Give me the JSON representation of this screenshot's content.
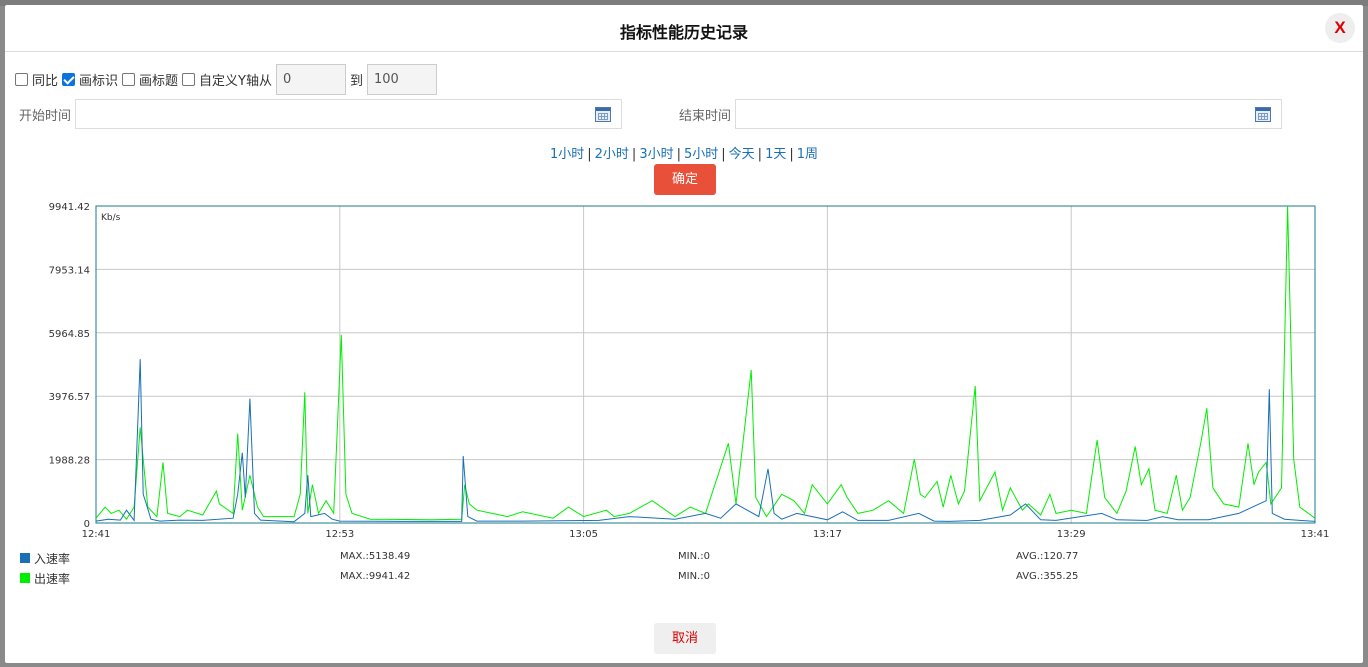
{
  "dialog": {
    "title": "指标性能历史记录",
    "close_label": "X"
  },
  "options": {
    "yoy_label": "同比",
    "yoy_checked": false,
    "draw_marks_label": "画标识",
    "draw_marks_checked": true,
    "draw_title_label": "画标题",
    "draw_title_checked": false,
    "custom_y_label": "自定义Y轴从",
    "custom_y_checked": false,
    "y_from": "0",
    "to_label": "到",
    "y_to": "100"
  },
  "time": {
    "start_label": "开始时间",
    "start_value": "",
    "end_label": "结束时间",
    "end_value": ""
  },
  "ranges": [
    "1小时",
    "2小时",
    "3小时",
    "5小时",
    "今天",
    "1天",
    "1周"
  ],
  "range_separator": "|",
  "confirm_label": "确定",
  "cancel_label": "取消",
  "colors": {
    "in_rate": "#1a6fb5",
    "out_rate": "#00ee00",
    "confirm": "#e8503a"
  },
  "chart_data": {
    "type": "line",
    "unit": "Kb/s",
    "ylim": [
      0,
      9941.42
    ],
    "yticks": [
      "0",
      "1988.28",
      "3976.57",
      "5964.85",
      "7953.14",
      "9941.42"
    ],
    "xticks": [
      "12:41",
      "12:53",
      "13:05",
      "13:17",
      "13:29",
      "13:41"
    ],
    "x_start": "12:41",
    "x_end": "13:41",
    "grid": true,
    "series": [
      {
        "name": "入速率",
        "max": "MAX.:5138.49",
        "min": "MIN.:0",
        "avg": "AVG.:120.77",
        "points": [
          [
            0,
            60
          ],
          [
            0.8,
            120
          ],
          [
            1.6,
            90
          ],
          [
            2,
            400
          ],
          [
            2.5,
            80
          ],
          [
            2.9,
            5138
          ],
          [
            3.1,
            900
          ],
          [
            3.3,
            600
          ],
          [
            3.6,
            120
          ],
          [
            4.2,
            60
          ],
          [
            5.5,
            90
          ],
          [
            7,
            80
          ],
          [
            9,
            150
          ],
          [
            9.3,
            900
          ],
          [
            9.6,
            2200
          ],
          [
            9.8,
            800
          ],
          [
            10.1,
            3900
          ],
          [
            10.4,
            300
          ],
          [
            10.8,
            90
          ],
          [
            13,
            40
          ],
          [
            13.7,
            300
          ],
          [
            13.9,
            1500
          ],
          [
            14.1,
            200
          ],
          [
            15,
            300
          ],
          [
            15.5,
            120
          ],
          [
            16,
            60
          ],
          [
            20,
            50
          ],
          [
            24,
            50
          ],
          [
            24.1,
            2100
          ],
          [
            24.4,
            200
          ],
          [
            25,
            60
          ],
          [
            28,
            60
          ],
          [
            33,
            80
          ],
          [
            35,
            200
          ],
          [
            38,
            120
          ],
          [
            40,
            300
          ],
          [
            41,
            150
          ],
          [
            42,
            600
          ],
          [
            43.5,
            200
          ],
          [
            44.1,
            1700
          ],
          [
            44.5,
            300
          ],
          [
            45,
            120
          ],
          [
            46,
            300
          ],
          [
            48,
            100
          ],
          [
            49,
            350
          ],
          [
            50,
            80
          ],
          [
            52,
            80
          ],
          [
            54,
            300
          ],
          [
            55,
            60
          ],
          [
            56,
            50
          ],
          [
            58,
            80
          ],
          [
            60,
            250
          ],
          [
            61,
            600
          ],
          [
            62,
            100
          ],
          [
            63,
            80
          ],
          [
            66,
            300
          ],
          [
            67,
            100
          ],
          [
            69,
            80
          ],
          [
            70,
            200
          ],
          [
            71,
            100
          ],
          [
            73,
            100
          ],
          [
            75,
            300
          ],
          [
            76.8,
            700
          ],
          [
            77,
            4200
          ],
          [
            77.2,
            300
          ],
          [
            78,
            120
          ],
          [
            79,
            80
          ],
          [
            80,
            50
          ]
        ]
      },
      {
        "name": "出速率",
        "max": "MAX.:9941.42",
        "min": "MIN.:0",
        "avg": "AVG.:355.25",
        "points": [
          [
            0,
            150
          ],
          [
            0.6,
            500
          ],
          [
            1,
            300
          ],
          [
            1.5,
            400
          ],
          [
            2,
            120
          ],
          [
            2.5,
            500
          ],
          [
            2.9,
            3000
          ],
          [
            3.1,
            2000
          ],
          [
            3.4,
            500
          ],
          [
            4,
            200
          ],
          [
            4.4,
            1900
          ],
          [
            4.7,
            300
          ],
          [
            5.5,
            200
          ],
          [
            6,
            400
          ],
          [
            7,
            250
          ],
          [
            7.9,
            1000
          ],
          [
            8.1,
            600
          ],
          [
            9,
            300
          ],
          [
            9.3,
            2800
          ],
          [
            9.6,
            400
          ],
          [
            10.1,
            1500
          ],
          [
            10.6,
            500
          ],
          [
            11,
            200
          ],
          [
            13,
            200
          ],
          [
            13.4,
            900
          ],
          [
            13.7,
            4100
          ],
          [
            13.9,
            300
          ],
          [
            14.2,
            1200
          ],
          [
            14.6,
            300
          ],
          [
            15.1,
            700
          ],
          [
            15.6,
            300
          ],
          [
            16.1,
            5900
          ],
          [
            16.4,
            900
          ],
          [
            16.8,
            300
          ],
          [
            18,
            120
          ],
          [
            22,
            100
          ],
          [
            24,
            120
          ],
          [
            24.2,
            1200
          ],
          [
            24.5,
            600
          ],
          [
            25,
            400
          ],
          [
            26,
            300
          ],
          [
            27,
            200
          ],
          [
            28,
            350
          ],
          [
            30,
            150
          ],
          [
            31,
            500
          ],
          [
            32,
            200
          ],
          [
            33.5,
            400
          ],
          [
            34,
            200
          ],
          [
            35,
            300
          ],
          [
            36.5,
            700
          ],
          [
            38,
            200
          ],
          [
            39,
            500
          ],
          [
            40,
            300
          ],
          [
            41.5,
            2500
          ],
          [
            42,
            600
          ],
          [
            43,
            4800
          ],
          [
            43.3,
            800
          ],
          [
            44,
            200
          ],
          [
            45,
            900
          ],
          [
            45.8,
            700
          ],
          [
            46.5,
            300
          ],
          [
            47,
            1200
          ],
          [
            48,
            600
          ],
          [
            48.9,
            1200
          ],
          [
            49.3,
            800
          ],
          [
            50,
            300
          ],
          [
            51,
            400
          ],
          [
            52,
            700
          ],
          [
            53,
            300
          ],
          [
            53.7,
            2000
          ],
          [
            54.1,
            900
          ],
          [
            54.4,
            800
          ],
          [
            55.2,
            1300
          ],
          [
            55.6,
            500
          ],
          [
            56.1,
            1500
          ],
          [
            56.6,
            600
          ],
          [
            57,
            1000
          ],
          [
            57.7,
            4300
          ],
          [
            58,
            700
          ],
          [
            59,
            1600
          ],
          [
            59.5,
            400
          ],
          [
            60,
            1100
          ],
          [
            60.8,
            400
          ],
          [
            61.2,
            600
          ],
          [
            62,
            250
          ],
          [
            62.6,
            900
          ],
          [
            63,
            300
          ],
          [
            64,
            400
          ],
          [
            65,
            300
          ],
          [
            65.7,
            2600
          ],
          [
            66.2,
            800
          ],
          [
            67,
            300
          ],
          [
            67.6,
            1000
          ],
          [
            68.2,
            2400
          ],
          [
            68.6,
            1200
          ],
          [
            69.1,
            1700
          ],
          [
            69.5,
            400
          ],
          [
            70.3,
            300
          ],
          [
            70.9,
            1500
          ],
          [
            71.3,
            400
          ],
          [
            71.8,
            800
          ],
          [
            72.5,
            2500
          ],
          [
            72.9,
            3600
          ],
          [
            73.3,
            1100
          ],
          [
            74,
            600
          ],
          [
            75,
            500
          ],
          [
            75.6,
            2500
          ],
          [
            76,
            1200
          ],
          [
            76.3,
            1600
          ],
          [
            76.8,
            1900
          ],
          [
            77.1,
            600
          ],
          [
            77.8,
            1100
          ],
          [
            78.2,
            9941
          ],
          [
            78.6,
            2000
          ],
          [
            79,
            500
          ],
          [
            80,
            150
          ]
        ]
      }
    ]
  }
}
